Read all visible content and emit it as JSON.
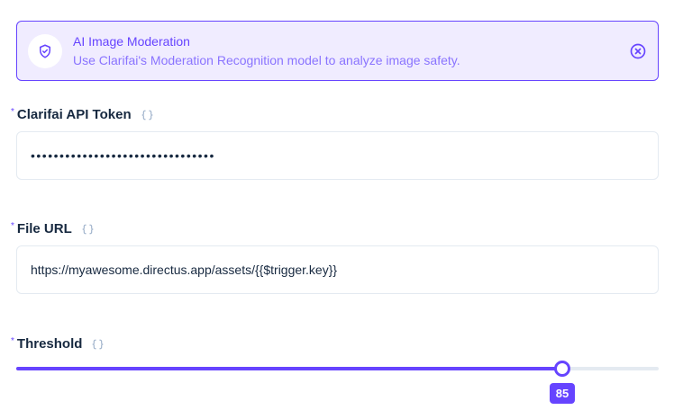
{
  "notice": {
    "title": "AI Image Moderation",
    "description": "Use Clarifai's Moderation Recognition model to analyze image safety.",
    "icon": "shield-check-icon",
    "close_icon": "close-circle-icon",
    "accent_color": "#6644ff"
  },
  "fields": {
    "api_token": {
      "label": "Clarifai API Token",
      "required_marker": "*",
      "value": "••••••••••••••••••••••••••••••••",
      "raw_icon": "braces-icon"
    },
    "file_url": {
      "label": "File URL",
      "required_marker": "*",
      "value": "https://myawesome.directus.app/assets/{{$trigger.key}}",
      "raw_icon": "braces-icon"
    },
    "threshold": {
      "label": "Threshold",
      "required_marker": "*",
      "value": 85,
      "value_label": "85",
      "min": 0,
      "max": 100,
      "raw_icon": "braces-icon"
    }
  }
}
